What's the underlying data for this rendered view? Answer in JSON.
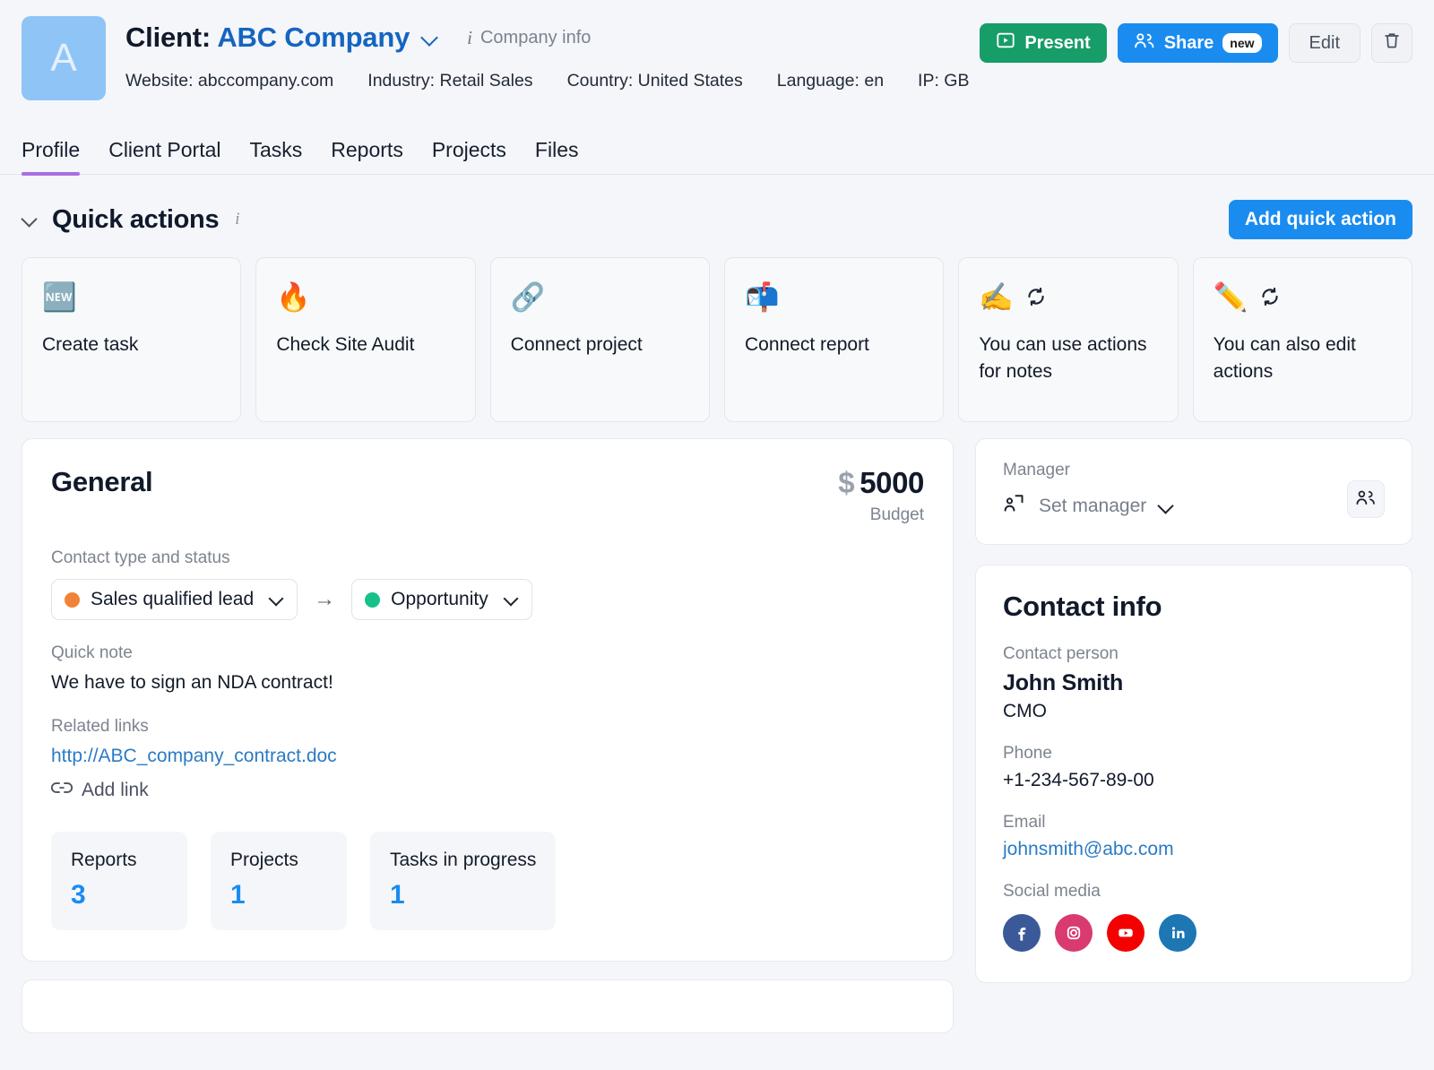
{
  "header": {
    "avatar_letter": "A",
    "title_prefix": "Client:",
    "client_name": "ABC Company",
    "company_info_label": "Company info",
    "meta": [
      "Website: abccompany.com",
      "Industry: Retail Sales",
      "Country: United States",
      "Language: en",
      "IP: GB"
    ],
    "actions": {
      "present_label": "Present",
      "share_label": "Share",
      "share_badge": "new",
      "edit_label": "Edit",
      "delete_icon": "trash-icon"
    }
  },
  "tabs": [
    {
      "label": "Profile",
      "active": true
    },
    {
      "label": "Client Portal",
      "active": false
    },
    {
      "label": "Tasks",
      "active": false
    },
    {
      "label": "Reports",
      "active": false
    },
    {
      "label": "Projects",
      "active": false
    },
    {
      "label": "Files",
      "active": false
    }
  ],
  "quick_actions": {
    "section_title": "Quick actions",
    "add_button_label": "Add quick action",
    "cards": [
      {
        "emoji": "🆕",
        "label": "Create task",
        "sync": false
      },
      {
        "emoji": "🔥",
        "label": "Check Site Audit",
        "sync": false
      },
      {
        "emoji": "🔗",
        "label": "Connect project",
        "sync": false
      },
      {
        "emoji": "📬",
        "label": "Connect report",
        "sync": false
      },
      {
        "emoji": "✍️",
        "label": "You can use actions for notes",
        "sync": true
      },
      {
        "emoji": "✏️",
        "label": "You can also edit actions",
        "sync": true
      }
    ]
  },
  "general": {
    "title": "General",
    "budget_currency": "$",
    "budget_value": "5000",
    "budget_label": "Budget",
    "contact_type_label": "Contact type and status",
    "status_from": "Sales qualified lead",
    "status_from_color": "#f08337",
    "status_to": "Opportunity",
    "status_to_color": "#18c18a",
    "quick_note_label": "Quick note",
    "quick_note_value": "We have to sign an NDA contract!",
    "related_links_label": "Related links",
    "related_link": "http://ABC_company_contract.doc",
    "add_link_label": "Add link",
    "stats": [
      {
        "label": "Reports",
        "value": "3"
      },
      {
        "label": "Projects",
        "value": "1"
      },
      {
        "label": "Tasks in progress",
        "value": "1"
      }
    ]
  },
  "manager": {
    "label": "Manager",
    "set_manager_label": "Set manager"
  },
  "contact_info": {
    "title": "Contact info",
    "contact_person_label": "Contact person",
    "contact_person_name": "John Smith",
    "contact_person_role": "CMO",
    "phone_label": "Phone",
    "phone_value": "+1-234-567-89-00",
    "email_label": "Email",
    "email_value": "johnsmith@abc.com",
    "social_label": "Social media",
    "socials": [
      {
        "name": "facebook",
        "color": "#3b5998"
      },
      {
        "name": "instagram",
        "color": "#d93a70"
      },
      {
        "name": "youtube",
        "color": "#f40000"
      },
      {
        "name": "linkedin",
        "color": "#1c77b3"
      }
    ]
  },
  "colors": {
    "brand_blue": "#1a8cf0",
    "present_green": "#179d68",
    "tab_accent": "#a66fe0",
    "link_blue": "#2b7bc4"
  }
}
